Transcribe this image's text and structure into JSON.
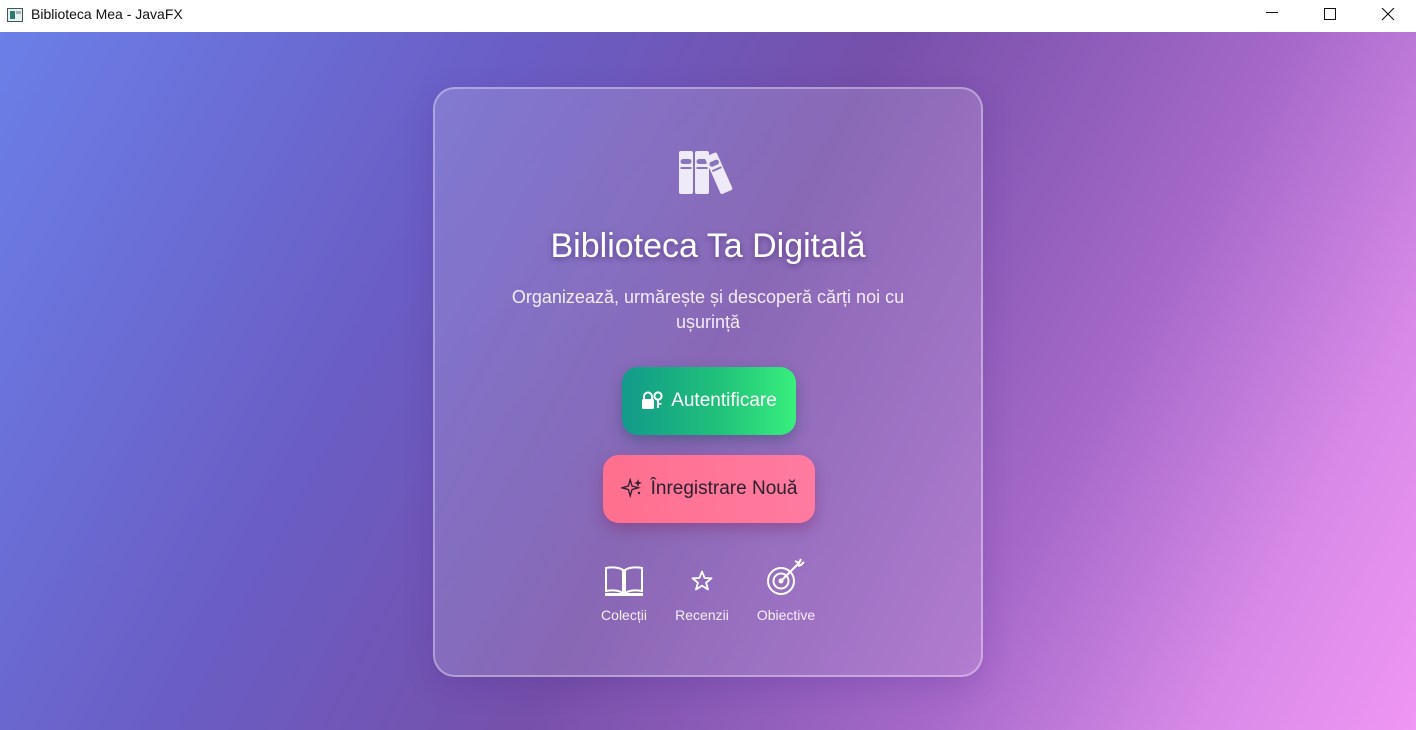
{
  "window": {
    "title": "Biblioteca Mea - JavaFX",
    "controls": [
      "minimize-icon",
      "maximize-icon",
      "close-icon"
    ]
  },
  "card": {
    "icon": "books-icon",
    "title": "Biblioteca Ta Digitală",
    "subtitle": "Organizează, urmărește și descoperă cărți noi cu ușurință"
  },
  "actions": {
    "login": {
      "label": "Autentificare",
      "icon": "lock-key-icon"
    },
    "register": {
      "label": "Înregistrare Nouă",
      "icon": "sparkles-icon"
    }
  },
  "features": [
    {
      "label": "Colecții",
      "icon": "open-book-icon"
    },
    {
      "label": "Recenzii",
      "icon": "star-icon"
    },
    {
      "label": "Obiective",
      "icon": "target-icon"
    }
  ],
  "colors": {
    "login_gradient": [
      "#129a8a",
      "#38ef7d"
    ],
    "register_gradient": [
      "#ff6f8e",
      "#ff7ba0"
    ],
    "background_gradient": [
      "#6b7fe8",
      "#7650aa",
      "#f096f4"
    ]
  }
}
